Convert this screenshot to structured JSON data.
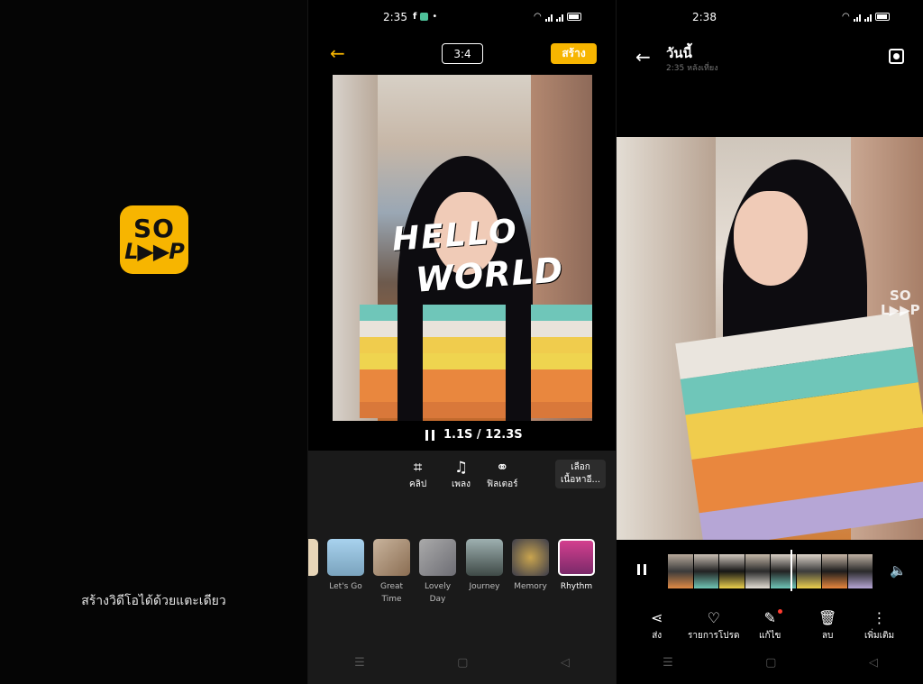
{
  "splash": {
    "logo_top": "SO",
    "logo_bottom": "L▶▶P",
    "tagline": "สร้างวิดีโอได้ด้วยแตะเดียว"
  },
  "editor": {
    "status_time": "2:35",
    "ratio": "3:4",
    "create": "สร้าง",
    "sticker_line1": "HELLO",
    "sticker_line2": "WORLD",
    "playback": "1.1S / 12.3S",
    "tools": [
      {
        "icon": "clip-icon",
        "label": "คลิป"
      },
      {
        "icon": "music-icon",
        "label": "เพลง"
      },
      {
        "icon": "filter-icon",
        "label": "ฟิลเตอร์"
      }
    ],
    "pick_content_line1": "เลือก",
    "pick_content_line2": "เนื้อหาอี...",
    "themes": [
      {
        "label": "",
        "color": "#e8d6b8"
      },
      {
        "label": "Let's Go",
        "color": "#8bb3cf"
      },
      {
        "label": "Great Time",
        "color": "#b7a189"
      },
      {
        "label": "Lovely Day",
        "color": "#9a9aa0"
      },
      {
        "label": "Journey",
        "color": "#5f6f6a"
      },
      {
        "label": "Memory",
        "color": "#5a4c53"
      },
      {
        "label": "Rhythm",
        "color": "#a03a7a"
      }
    ]
  },
  "gallery": {
    "status_time": "2:38",
    "title": "วันนี้",
    "subtitle": "2:35 หลังเที่ยง",
    "watermark_line1": "SO",
    "watermark_line2": "L▶▶P",
    "actions": [
      {
        "icon": "share-icon",
        "label": "ส่ง"
      },
      {
        "icon": "heart-icon",
        "label": "รายการโปรด"
      },
      {
        "icon": "edit-icon",
        "label": "แก้ไข"
      },
      {
        "icon": "trash-icon",
        "label": "ลบ"
      },
      {
        "icon": "more-icon",
        "label": "เพิ่มเติม"
      }
    ]
  },
  "colors": {
    "accent": "#f7b500",
    "background": "#000000",
    "panel": "#1a1a1a"
  }
}
